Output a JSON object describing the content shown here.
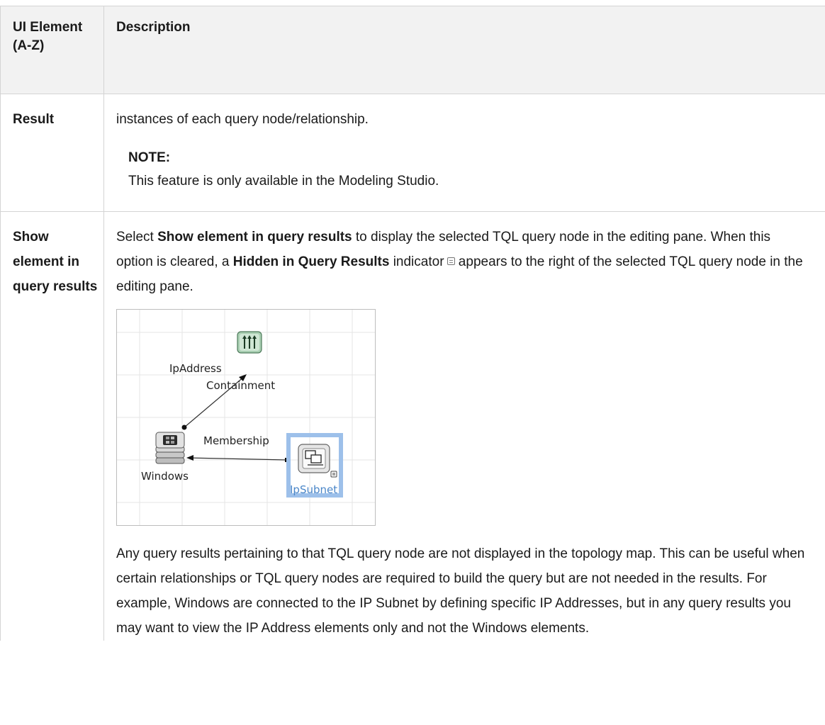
{
  "table": {
    "header": {
      "element_col": "UI Element (A-Z)",
      "description_col": "Description"
    },
    "rows": [
      {
        "name": "Result",
        "text": "instances of each query node/relationship.",
        "note_title": "NOTE:",
        "note_text": "This feature is only available in the Modeling Studio."
      },
      {
        "name": "Show element in query results",
        "p1_a": "Select ",
        "p1_b": "Show element in query results",
        "p1_c": " to display the selected TQL query node in the editing pane. When this option is cleared, a ",
        "p1_d": "Hidden in Query Results",
        "p1_e": " indicator",
        "p1_f": " appears to the right of the selected TQL query node in the editing pane.",
        "figure": {
          "nodes": {
            "ip_address": "IpAddress",
            "windows": "Windows",
            "ip_subnet": "IpSubnet"
          },
          "edges": {
            "containment": "Containment",
            "membership": "Membership"
          },
          "selection_color": "#9dc0ea",
          "label_selected_color": "#4a86c8"
        },
        "p2": "Any query results pertaining to that TQL query node are not displayed in the topology map. This can be useful when certain relationships or TQL query nodes are required to build the query but are not needed in the results. For example, Windows are connected to the IP Subnet by defining specific IP Addresses, but in any query results you may want to view the IP Address elements only and not the Windows elements."
      }
    ]
  }
}
